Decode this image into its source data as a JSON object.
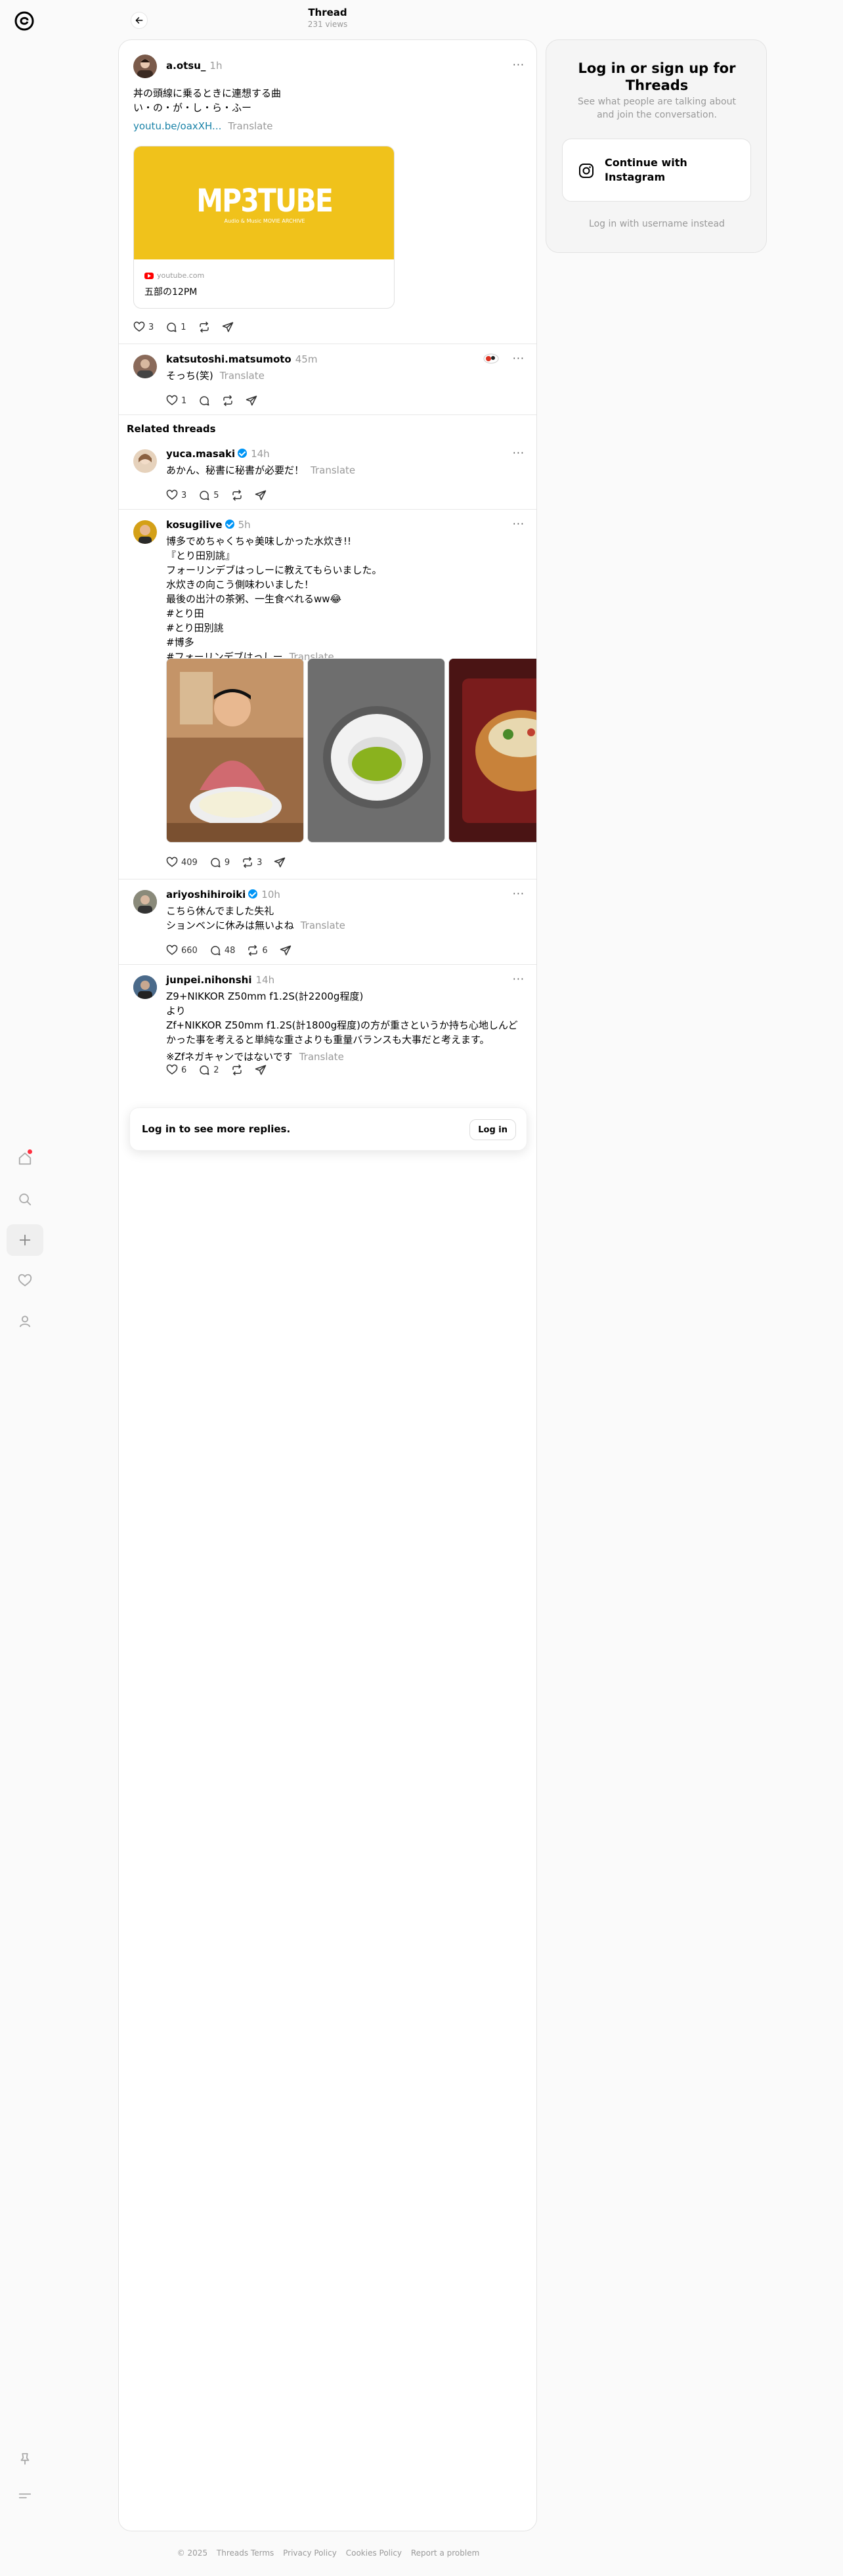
{
  "header": {
    "title": "Thread",
    "views": "231 views"
  },
  "main_post": {
    "username": "a.otsu_",
    "time": "1h",
    "lines": [
      "丼の頭線に乗るときに連想する曲",
      "い・の・が・し・ら・ふー"
    ],
    "link": "youtu.be/oaxXH...",
    "translate": "Translate",
    "card": {
      "logo": "MP3TUBE",
      "tagline": "Audio & Music MOVIE ARCHIVE",
      "source": "youtube.com",
      "title": "五部の12PM"
    },
    "likes": "3",
    "replies": "1"
  },
  "reply": {
    "username": "katsutoshi.matsumoto",
    "time": "45m",
    "text": "そっち(笑)",
    "translate": "Translate",
    "likes": "1"
  },
  "related_title": "Related threads",
  "related": [
    {
      "username": "yuca.masaki",
      "verified": true,
      "time": "14h",
      "lines": [
        "あかん、秘書に秘書が必要だ！"
      ],
      "translate": "Translate",
      "likes": "3",
      "replies": "5",
      "reposts": ""
    },
    {
      "username": "kosugilive",
      "verified": true,
      "time": "5h",
      "lines": [
        "博多でめちゃくちゃ美味しかった水炊き!!",
        "『とり田別誂』",
        "フォーリンデブはっしーに教えてもらいました。",
        "水炊きの向こう側味わいました！",
        "最後の出汁の茶粥、一生食べれるww😂",
        "#とり田",
        "#とり田別誂",
        "#博多",
        "#フォーリンデブはっしー"
      ],
      "translate": "Translate",
      "likes": "409",
      "replies": "9",
      "reposts": "3"
    },
    {
      "username": "ariyoshihiroiki",
      "verified": true,
      "time": "10h",
      "lines": [
        "こちら休んでました失礼",
        "ションベンに休みは無いよね"
      ],
      "translate": "Translate",
      "likes": "660",
      "replies": "48",
      "reposts": "6"
    },
    {
      "username": "junpei.nihonshi",
      "verified": false,
      "time": "14h",
      "lines": [
        "Z9+NIKKOR Z50mm f1.2S(計2200g程度)",
        "より",
        "Zf+NIKKOR Z50mm f1.2S(計1800g程度)の方が重さというか持ち心地しんど",
        "かった事を考えると単純な重さよりも重量バランスも大事だと考えます。",
        "",
        "※Zfネガキャンではないです"
      ],
      "translate": "Translate",
      "likes": "6",
      "replies": "2",
      "reposts": ""
    }
  ],
  "login_prompt": {
    "text": "Log in to see more replies.",
    "button": "Log in"
  },
  "sidebar": {
    "title_line1": "Log in or sign up for",
    "title_line2": "Threads",
    "subtitle_line1": "See what people are talking about",
    "subtitle_line2": "and join the conversation.",
    "ig_line1": "Continue with",
    "ig_line2": "Instagram",
    "alt": "Log in with username instead"
  },
  "footer": [
    "© 2025",
    "Threads Terms",
    "Privacy Policy",
    "Cookies Policy",
    "Report a problem"
  ],
  "colors": {
    "link": "#1a83a8",
    "verified": "#0095f6",
    "card_bg": "#f0c21b",
    "notification_dot": "#ff3040"
  }
}
